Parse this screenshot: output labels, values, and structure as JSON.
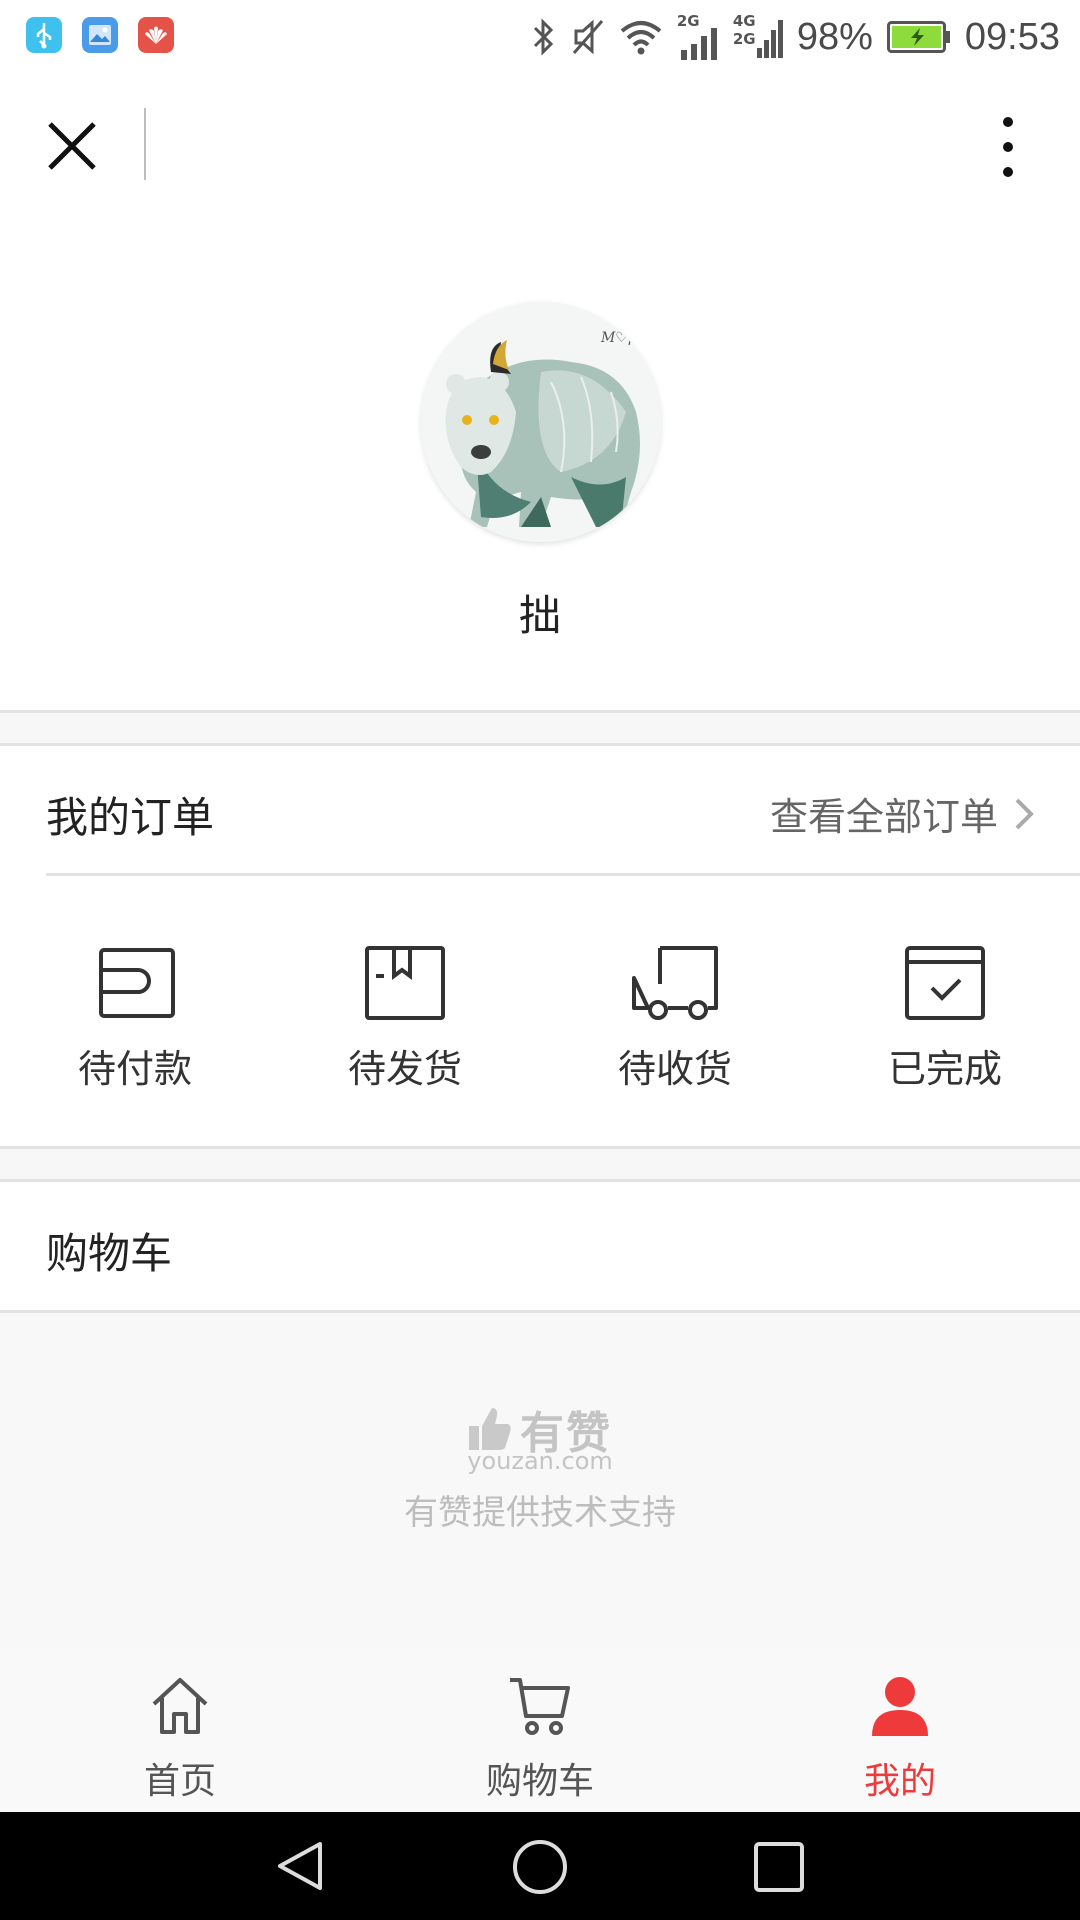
{
  "status_bar": {
    "apps": [
      "usb-icon",
      "gallery-icon",
      "huawei-icon"
    ],
    "net_top": "2G",
    "net_4g": "4G",
    "net_2g": "2G",
    "battery_percent": "98%",
    "time": "09:53"
  },
  "top_bar": {
    "close_icon": "close-icon",
    "more_icon": "more-vertical-icon"
  },
  "profile": {
    "avatar": "bear-avatar",
    "username": "拙"
  },
  "orders": {
    "title": "我的订单",
    "view_all": "查看全部订单",
    "items": [
      {
        "label": "待付款",
        "icon": "wallet-icon"
      },
      {
        "label": "待发货",
        "icon": "package-icon"
      },
      {
        "label": "待收货",
        "icon": "truck-icon"
      },
      {
        "label": "已完成",
        "icon": "check-box-icon"
      }
    ]
  },
  "cart": {
    "title": "购物车"
  },
  "footer": {
    "brand": "有赞",
    "domain": "youzan.com",
    "support": "有赞提供技术支持"
  },
  "tabs": [
    {
      "label": "首页",
      "icon": "home-icon",
      "active": false
    },
    {
      "label": "购物车",
      "icon": "cart-icon",
      "active": false
    },
    {
      "label": "我的",
      "icon": "user-icon",
      "active": true
    }
  ],
  "colors": {
    "accent": "#ee3a3a",
    "band": "#f7f7f7",
    "divider": "#e3e3e3"
  }
}
